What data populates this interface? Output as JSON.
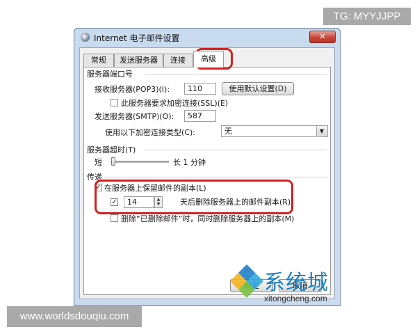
{
  "window": {
    "title": "Internet 电子邮件设置",
    "close_label": "✕"
  },
  "tabs": [
    {
      "label": "常规",
      "active": false
    },
    {
      "label": "发送服务器",
      "active": false
    },
    {
      "label": "连接",
      "active": false
    },
    {
      "label": "高级",
      "active": true
    }
  ],
  "server_ports": {
    "group_label": "服务器端口号",
    "incoming_label": "接收服务器(POP3)(I):",
    "incoming_value": "110",
    "default_button_label": "使用默认设置(D)",
    "ssl_label": "此服务器要求加密连接(SSL)(E)",
    "ssl_checked": false,
    "outgoing_label": "发送服务器(SMTP)(O):",
    "outgoing_value": "587",
    "encryption_label": "使用以下加密连接类型(C):",
    "encryption_value": "无"
  },
  "timeout": {
    "group_label": "服务器超时(T)",
    "short_label": "短",
    "long_label": "长 1 分钟",
    "level": 0.05
  },
  "delivery": {
    "group_label": "传递",
    "leave_copy_label": "在服务器上保留邮件的副本(L)",
    "leave_copy_checked": true,
    "remove_after_checked": true,
    "remove_after_days": "14",
    "remove_after_label": "天后删除服务器上的邮件副本(R)",
    "remove_deleted_label": "删除“已删除邮件”时，同时删除服务器上的副本(M)",
    "remove_deleted_checked": false
  },
  "footer": {
    "ok_label": "确定",
    "cancel_label": "取消"
  },
  "overlays": {
    "top_right_tag": "TG: MYYJJPP",
    "bottom_left_tag": "www.worldsdouqiu.com",
    "watermark_brand": "系统城",
    "watermark_url": "xitongcheng.com"
  },
  "colors": {
    "highlight": "#d42020",
    "window_frame": "#c9dcef",
    "watermark_blue": "#1a7fc0"
  }
}
